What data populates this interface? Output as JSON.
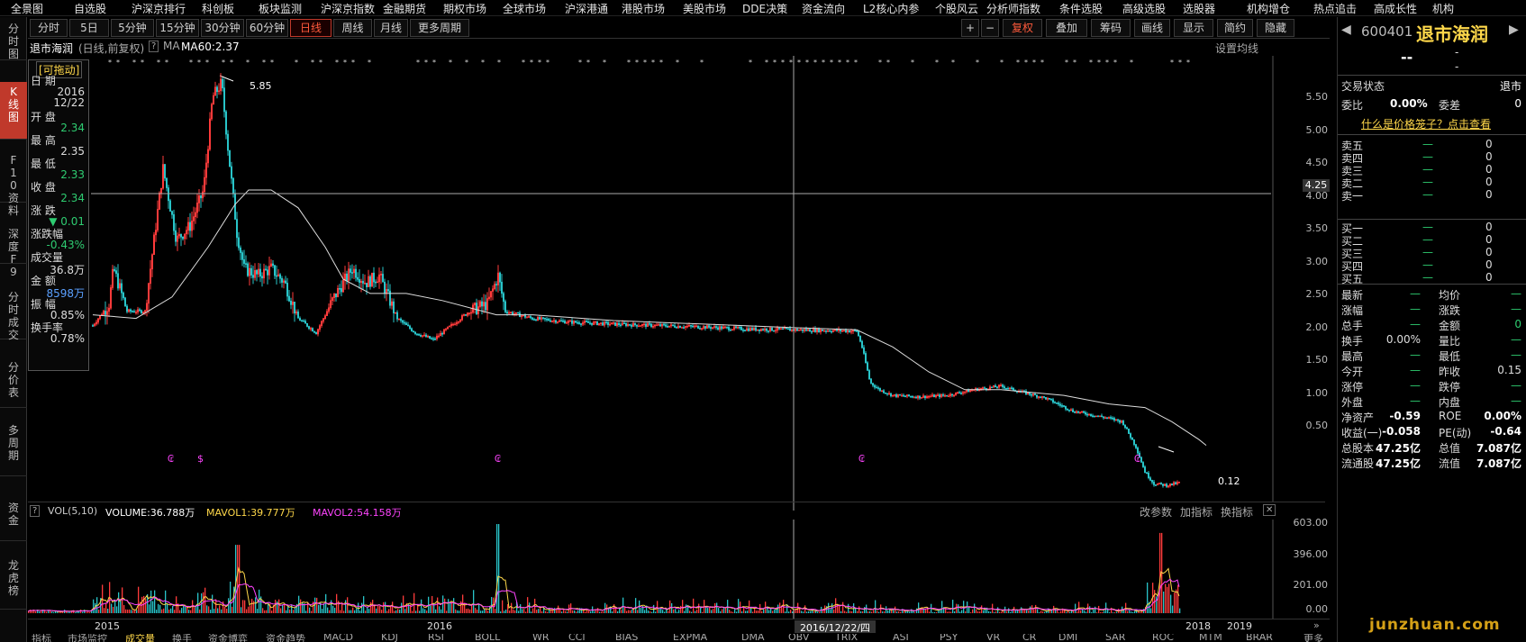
{
  "top_menu": [
    "全景图",
    "自选股",
    "沪深京排行",
    "科创板",
    "板块监测",
    "沪深京指数",
    "金融期货",
    "期权市场",
    "全球市场",
    "沪深港通",
    "港股市场",
    "美股市场",
    "DDE决策",
    "资金流向",
    "L2核心内参",
    "个股风云",
    "分析师指数",
    "条件选股",
    "高级选股",
    "选股器",
    "机构增仓",
    "热点追击",
    "高成长性",
    "机构"
  ],
  "left_bar": [
    "分时图",
    "K线图",
    "F10资料",
    "深度F9",
    "分时成交",
    "分价表",
    "多周期",
    "资金",
    "龙虎榜"
  ],
  "period_tabs": [
    "分时",
    "5日",
    "5分钟",
    "15分钟",
    "30分钟",
    "60分钟",
    "日线",
    "周线",
    "月线",
    "更多周期"
  ],
  "toolbar_right": [
    "+",
    "−",
    "复权",
    "叠加",
    "筹码",
    "画线",
    "显示",
    "简约",
    "隐藏"
  ],
  "chart_header": {
    "name": "退市海润",
    "mode": "(日线,前复权)",
    "ma_label": "MA",
    "ma_value": "MA60:2.37",
    "settings": "设置均线"
  },
  "info_box": {
    "drag": "[可拖动]",
    "rows": [
      {
        "k": "日 期",
        "v": "2016"
      },
      {
        "k": "",
        "v": "12/22"
      },
      {
        "k": "开 盘",
        "v": "2.34",
        "c": "g"
      },
      {
        "k": "最 高",
        "v": "2.35"
      },
      {
        "k": "最 低",
        "v": "2.33",
        "c": "g"
      },
      {
        "k": "收 盘",
        "v": "2.34",
        "c": "g"
      },
      {
        "k": "涨 跌",
        "v": "▼ 0.01",
        "c": "g"
      },
      {
        "k": "涨跌幅",
        "v": "-0.43%",
        "c": "g"
      },
      {
        "k": "成交量",
        "v": "36.8万"
      },
      {
        "k": "金 额",
        "v": "8598万",
        "c": "b"
      },
      {
        "k": "振 幅",
        "v": "0.85%"
      },
      {
        "k": "换手率",
        "v": "0.78%"
      }
    ]
  },
  "price_axis": [
    "5.50",
    "5.00",
    "4.50",
    "4.00",
    "3.50",
    "3.00",
    "2.50",
    "2.00",
    "1.50",
    "1.00",
    "0.50"
  ],
  "cursor_price": "4.25",
  "annotations": {
    "high": "5.85",
    "low": "0.12"
  },
  "volume_header": {
    "label": "VOL(5,10)",
    "volume": "VOLUME:36.788万",
    "mavol1": "MAVOL1:39.777万",
    "mavol2": "MAVOL2:54.158万",
    "btn_params": "改参数",
    "btn_add": "加指标",
    "btn_switch": "换指标"
  },
  "volume_axis": [
    "603.00",
    "396.00",
    "201.00",
    "0.00"
  ],
  "x_axis": [
    "2015",
    "2016",
    "2018",
    "2019"
  ],
  "cursor_date": "2016/12/22/四",
  "right_panel": {
    "code": "600401",
    "name": "退市海润",
    "price_dash": "--",
    "dash2": "-",
    "status_label": "交易状态",
    "status_value": "退市",
    "wb_label": "委比",
    "wb_value": "0.00%",
    "wc_label": "委差",
    "wc_value": "0",
    "link": "什么是价格笼子？点击查看",
    "asks": [
      "卖五",
      "卖四",
      "卖三",
      "卖二",
      "卖一"
    ],
    "bids": [
      "买一",
      "买二",
      "买三",
      "买四",
      "买五"
    ],
    "book_dash": "—",
    "book_zero": "0",
    "stats": [
      {
        "k1": "最新",
        "v1": "—",
        "k2": "均价",
        "v2": "—"
      },
      {
        "k1": "涨幅",
        "v1": "—",
        "k2": "涨跌",
        "v2": "—"
      },
      {
        "k1": "总手",
        "v1": "—",
        "k2": "金额",
        "v2": "0"
      },
      {
        "k1": "换手",
        "v1": "0.00%",
        "k2": "量比",
        "v2": "—"
      },
      {
        "k1": "最高",
        "v1": "—",
        "k2": "最低",
        "v2": "—"
      },
      {
        "k1": "今开",
        "v1": "—",
        "k2": "昨收",
        "v2": "0.15"
      },
      {
        "k1": "涨停",
        "v1": "—",
        "k2": "跌停",
        "v2": "—"
      },
      {
        "k1": "外盘",
        "v1": "—",
        "k2": "内盘",
        "v2": "—"
      },
      {
        "k1": "净资产",
        "v1": "-0.59",
        "k2": "ROE",
        "v2": "0.00%"
      },
      {
        "k1": "收益(一)",
        "v1": "-0.058",
        "k2": "PE(动)",
        "v2": "-0.64"
      },
      {
        "k1": "总股本",
        "v1": "47.25亿",
        "k2": "总值",
        "v2": "7.087亿"
      },
      {
        "k1": "流通股",
        "v1": "47.25亿",
        "k2": "流值",
        "v2": "7.087亿"
      }
    ]
  },
  "bottom_tabs": [
    "指标",
    "市场监控",
    "成交量",
    "换手",
    "资金博弈",
    "资金趋势",
    "MACD",
    "KDJ",
    "RSI",
    "BOLL",
    "WR",
    "CCI",
    "BIAS",
    "EXPMA",
    "DMA",
    "OBV",
    "TRIX",
    "ASI",
    "PSY",
    "VR",
    "CR",
    "DMI",
    "SAR",
    "ROC",
    "MTM",
    "BRAR",
    "更多指标"
  ],
  "watermark": "junzhuan.com",
  "colors": {
    "up": "#ff3b3b",
    "down": "#29c4c9",
    "ma": "#ffffff",
    "mavol1": "#ffd84a",
    "mavol2": "#ff44ff",
    "accent": "#c0392b"
  }
}
